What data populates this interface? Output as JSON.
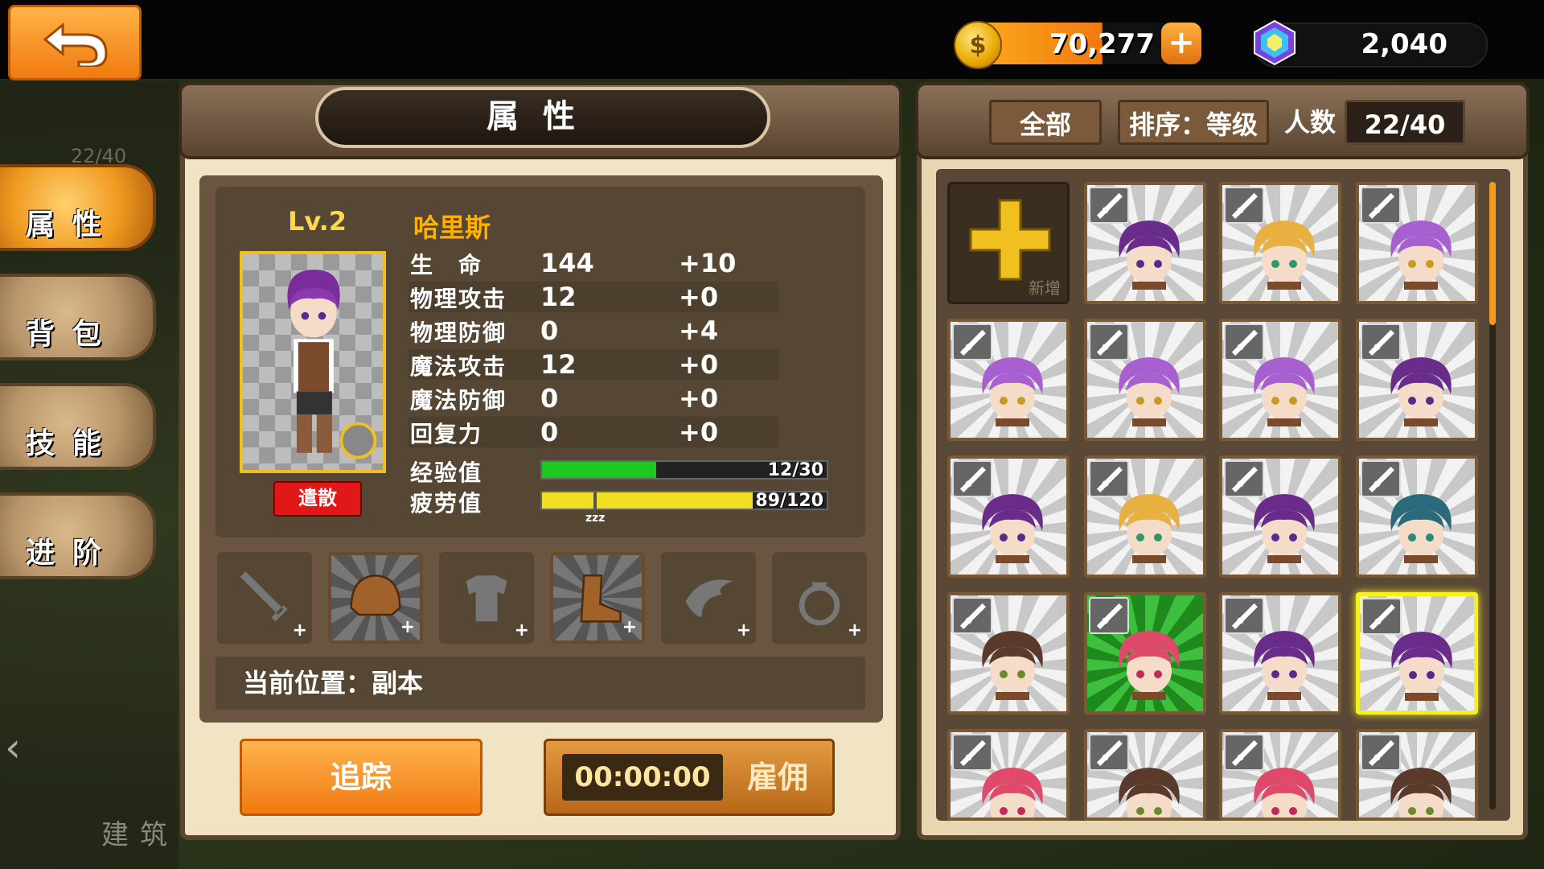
{
  "currency": {
    "gold": "70,277",
    "gold_plus": "+",
    "gems": "2,040"
  },
  "left_menu": {
    "faded_count": "22/40",
    "items": [
      {
        "label": "属性",
        "active": true
      },
      {
        "label": "背包",
        "active": false
      },
      {
        "label": "技能",
        "active": false
      },
      {
        "label": "进阶",
        "active": false
      }
    ],
    "building_label": "建筑",
    "chevron": "‹"
  },
  "attributes": {
    "title": "属性",
    "level": "Lv.2",
    "dismiss_label": "遣散",
    "hero_name": "哈里斯",
    "stats": [
      {
        "label": "生　命",
        "value": "144",
        "bonus": "+10"
      },
      {
        "label": "物理攻击",
        "value": "12",
        "bonus": "+0"
      },
      {
        "label": "物理防御",
        "value": "0",
        "bonus": "+4"
      },
      {
        "label": "魔法攻击",
        "value": "12",
        "bonus": "+0"
      },
      {
        "label": "魔法防御",
        "value": "0",
        "bonus": "+0"
      },
      {
        "label": "回复力",
        "value": "0",
        "bonus": "+0"
      }
    ],
    "exp": {
      "label": "经验值",
      "text": "12/30",
      "fraction": 0.4
    },
    "fatigue": {
      "label": "疲劳值",
      "text": "89/120",
      "fraction": 0.74,
      "marker_text": "zzz"
    },
    "equipment": [
      {
        "icon": "sword-icon",
        "filled": false
      },
      {
        "icon": "helmet-icon",
        "filled": true
      },
      {
        "icon": "armor-icon",
        "filled": false
      },
      {
        "icon": "boot-icon",
        "filled": true
      },
      {
        "icon": "wing-icon",
        "filled": false
      },
      {
        "icon": "ring-icon",
        "filled": false
      }
    ],
    "location": "当前位置：副本",
    "track_label": "追踪",
    "timer": "00:00:00",
    "hire_label": "雇佣"
  },
  "roster": {
    "filter_all": "全部",
    "sort": "排序：等级",
    "count_label": "人数",
    "count": "22/40",
    "add_label": "新增",
    "heroes": [
      {
        "hair": "#6a2c8a",
        "eyes": "#5a2a8a"
      },
      {
        "hair": "#e8b040",
        "eyes": "#2a9a6a"
      },
      {
        "hair": "#a860d0",
        "eyes": "#c89a20"
      },
      {
        "hair": "#a860d0",
        "eyes": "#c89a20"
      },
      {
        "hair": "#a860d0",
        "eyes": "#c89a20"
      },
      {
        "hair": "#a860d0",
        "eyes": "#c89a20"
      },
      {
        "hair": "#6a2c8a",
        "eyes": "#5a2a8a"
      },
      {
        "hair": "#6a2c8a",
        "eyes": "#5a2a8a"
      },
      {
        "hair": "#e8b040",
        "eyes": "#2a9a6a"
      },
      {
        "hair": "#6a2c8a",
        "eyes": "#5a2a8a"
      },
      {
        "hair": "#2a6a7a",
        "eyes": "#2a8a7a"
      },
      {
        "hair": "#5a3a2a",
        "eyes": "#6a8a2a"
      },
      {
        "hair": "#e04a6a",
        "eyes": "#c02a5a",
        "green": true
      },
      {
        "hair": "#6a2c8a",
        "eyes": "#5a2a8a"
      },
      {
        "hair": "#6a2c8a",
        "eyes": "#5a2a8a",
        "selected": true
      },
      {
        "hair": "#e04a6a",
        "eyes": "#c02a5a"
      },
      {
        "hair": "#5a3a2a",
        "eyes": "#6a8a2a"
      },
      {
        "hair": "#e04a6a",
        "eyes": "#c02a5a"
      },
      {
        "hair": "#5a3a2a",
        "eyes": "#6a8a2a"
      }
    ]
  }
}
